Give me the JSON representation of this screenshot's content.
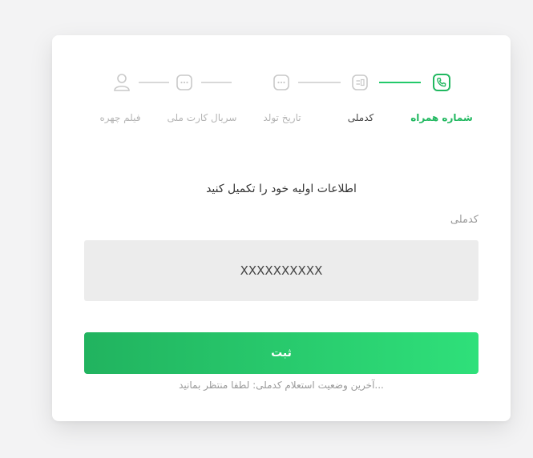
{
  "stepper": {
    "steps": [
      {
        "label": "شماره همراه",
        "icon": "phone-icon",
        "state": "completed"
      },
      {
        "label": "کدملی",
        "icon": "id-card-icon",
        "state": "current"
      },
      {
        "label": "تاریخ تولد",
        "icon": "dots-icon",
        "state": "pending"
      },
      {
        "label": "سریال کارت ملی",
        "icon": "dots-icon",
        "state": "pending"
      },
      {
        "label": "فیلم چهره",
        "icon": "user-icon",
        "state": "pending"
      }
    ],
    "colors": {
      "active": "#21b860",
      "inactive": "#c9c9c9"
    }
  },
  "form": {
    "instruction": "اطلاعات اولیه خود را تکمیل کنید",
    "field_label": "کدملی",
    "field_value": "XXXXXXXXXX",
    "submit_label": "ثبت",
    "status_text": "...آخرین وضعیت استعلام کدملی: لطفا منتظر بمانید"
  },
  "colors": {
    "button_gradient_start": "#21b35f",
    "button_gradient_end": "#2fe07a",
    "background": "#f3f3f4",
    "card": "#ffffff"
  }
}
